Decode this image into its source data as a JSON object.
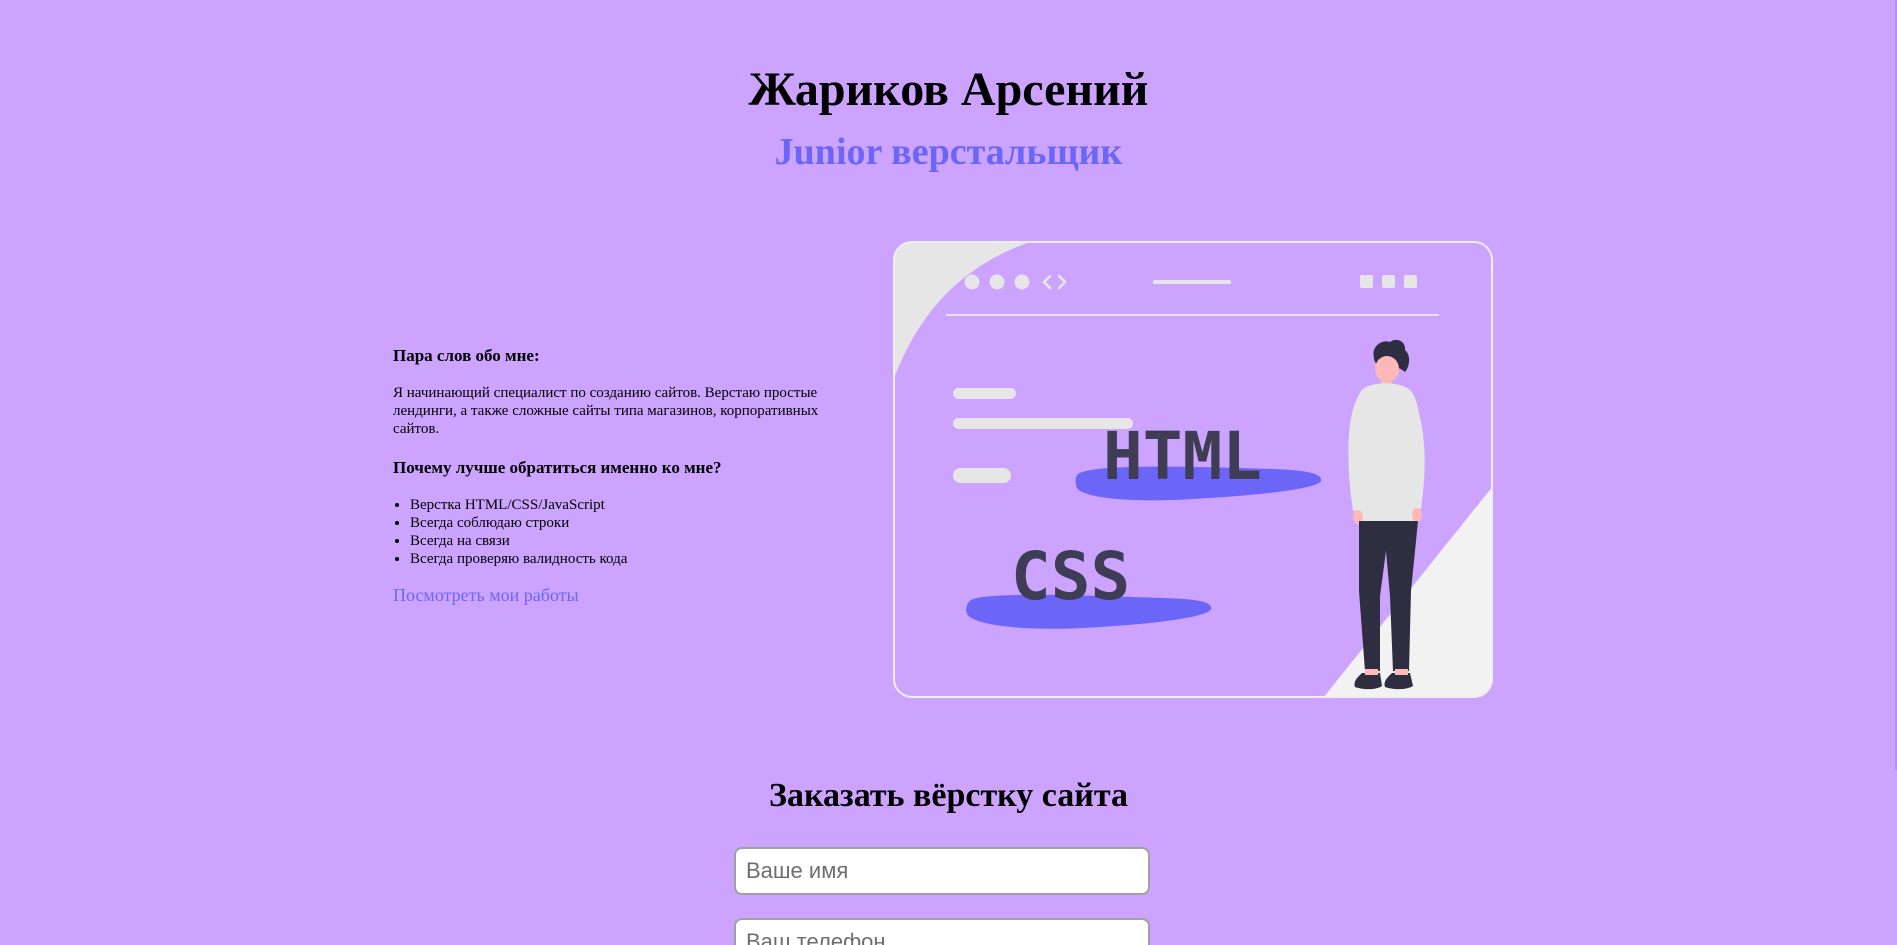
{
  "header": {
    "name": "Жариков Арсений",
    "role": "Junior верстальщик"
  },
  "about": {
    "heading": "Пара слов обо мне:",
    "text": "Я начинающий специалист по созданию сайтов. Верстаю простые лендинги, а также сложные сайты типа магазинов, корпоративных сайтов.",
    "why_heading": "Почему лучше обратиться именно ко мне?",
    "reasons": [
      "Верстка HTML/CSS/JavaScript",
      "Всегда соблюдаю строки",
      "Всегда на связи",
      "Всегда проверяю валидность кода"
    ],
    "portfolio_link": "Посмотреть мои работы"
  },
  "illustration": {
    "html_label": "HTML",
    "css_label": "CSS",
    "icon": "web-developer-illustration"
  },
  "order": {
    "title": "Заказать вёрстку сайта",
    "name_placeholder": "Ваше имя",
    "phone_placeholder": "Ваш телефон"
  },
  "colors": {
    "background": "#cca3fe",
    "accent": "#6b66f7",
    "text": "#000000"
  }
}
